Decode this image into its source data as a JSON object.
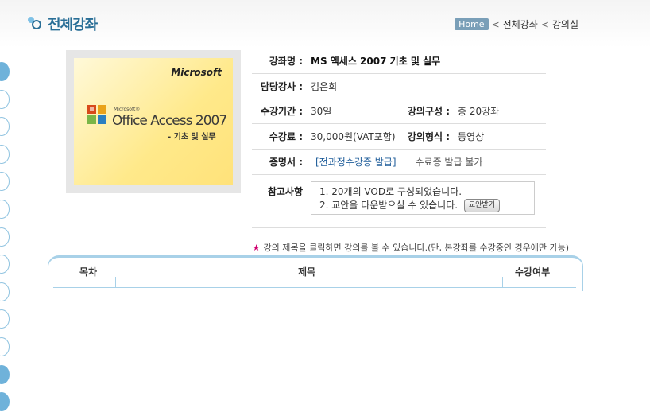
{
  "header": {
    "page_title": "전체강좌",
    "breadcrumb": {
      "home": "Home",
      "level1": "전체강좌",
      "level2": "강의실"
    }
  },
  "thumbnail": {
    "brand": "Microsoft",
    "small_brand": "Microsoft®",
    "product": "Office Access 2007",
    "subtitle": "- 기초 및 실무"
  },
  "course": {
    "name_label": "강좌명 :",
    "name": "MS 엑세스 2007 기초 및 실무",
    "instructor_label": "담당강사 :",
    "instructor": "김은희",
    "period_label": "수강기간 :",
    "period": "30일",
    "composition_label": "강의구성 :",
    "composition": "총 20강좌",
    "fee_label": "수강료 :",
    "fee": "30,000원(VAT포함)",
    "format_label": "강의형식 :",
    "format": "동영상",
    "certificate_label": "증명서 :",
    "certificate_link": "[전과정수강증 발급]",
    "certificate_note": "수료증 발급 불가",
    "notes_label": "참고사항",
    "notes": [
      "1. 20개의 VOD로 구성되었습니다.",
      "2. 교안을 다운받으실 수 있습니다."
    ],
    "download_button": "교안받기"
  },
  "hint": "강의 제목을 클릭하면 강의를 볼 수 있습니다.(단, 본강좌를 수강중인 경우에만 가능)",
  "table": {
    "headers": [
      "목차",
      "제목",
      "수강여부"
    ]
  },
  "colors": {
    "title": "#2a6f97",
    "accent_line": "#a8d1e8",
    "star": "#d0006f",
    "link": "#1f5d9a"
  }
}
